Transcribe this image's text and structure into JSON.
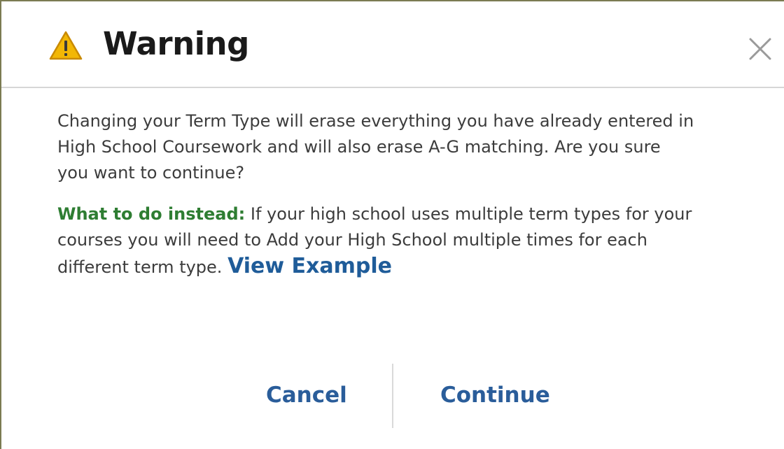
{
  "dialog": {
    "title": "Warning",
    "icon": "warning-triangle-icon",
    "close_icon": "close-icon",
    "message_lines": [
      "Changing your Term Type will erase everything you have already entered in",
      "High School Coursework and will also erase A-G matching. Are you sure",
      "you want to continue?"
    ],
    "instead_label": "What to do instead:",
    "instead_lines": [
      " If your high school uses multiple term types for your",
      "courses you will need to Add your High School multiple times for each",
      "different term type. "
    ],
    "view_example_label": "View Example",
    "cancel_label": "Cancel",
    "continue_label": "Continue",
    "colors": {
      "accent": "#2a5d9a",
      "instead_green": "#2e7d32",
      "warning_yellow": "#f2b705"
    }
  }
}
